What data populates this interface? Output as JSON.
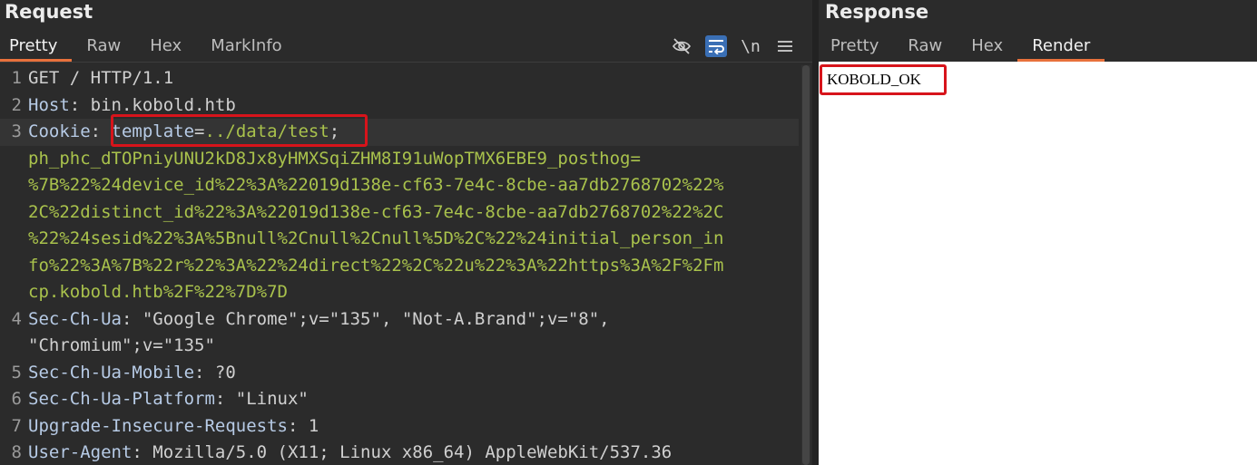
{
  "request": {
    "title": "Request",
    "tabs": [
      "Pretty",
      "Raw",
      "Hex",
      "MarkInfo"
    ],
    "active_tab": "Pretty",
    "tools": [
      {
        "name": "hide-eye-icon",
        "glyph": "",
        "active": false
      },
      {
        "name": "wrap-lines-icon",
        "glyph": "",
        "active": true
      },
      {
        "name": "newline-toggle",
        "glyph": "\\n",
        "active": false
      },
      {
        "name": "menu-icon",
        "glyph": "≡",
        "active": false
      }
    ],
    "lines": {
      "l1": {
        "num": "1",
        "text": "GET / HTTP/1.1"
      },
      "l2": {
        "num": "2",
        "key": "Host",
        "sep": ": ",
        "value": "bin.kobold.htb"
      },
      "l3": {
        "num": "3",
        "key": "Cookie",
        "sep": ": ",
        "cookie_name": "template",
        "cookie_eq": "=",
        "cookie_value": "../data/test",
        "cookie_semi": ";",
        "wrap1": "ph_phc_dTOPniyUNU2kD8Jx8yHMXSqiZHM8I91uWopTMX6EBE9_posthog=",
        "wrap2": "%7B%22%24device_id%22%3A%22019d138e-cf63-7e4c-8cbe-aa7db2768702%22%",
        "wrap3": "2C%22distinct_id%22%3A%22019d138e-cf63-7e4c-8cbe-aa7db2768702%22%2C",
        "wrap4": "%22%24sesid%22%3A%5Bnull%2Cnull%2Cnull%5D%2C%22%24initial_person_in",
        "wrap5": "fo%22%3A%7B%22r%22%3A%22%24direct%22%2C%22u%22%3A%22https%3A%2F%2Fm",
        "wrap6": "cp.kobold.htb%2F%22%7D%7D"
      },
      "l4": {
        "num": "4",
        "key": "Sec-Ch-Ua",
        "sep": ": ",
        "value": "\"Google Chrome\";v=\"135\", \"Not-A.Brand\";v=\"8\",",
        "wrap1": "\"Chromium\";v=\"135\""
      },
      "l5": {
        "num": "5",
        "key": "Sec-Ch-Ua-Mobile",
        "sep": ": ",
        "value": "?0"
      },
      "l6": {
        "num": "6",
        "key": "Sec-Ch-Ua-Platform",
        "sep": ": ",
        "value": "\"Linux\""
      },
      "l7": {
        "num": "7",
        "key": "Upgrade-Insecure-Requests",
        "sep": ": ",
        "value": "1"
      },
      "l8": {
        "num": "8",
        "key": "User-Agent",
        "sep": ": ",
        "value": "Mozilla/5.0 (X11; Linux x86_64) AppleWebKit/537.36"
      }
    }
  },
  "response": {
    "title": "Response",
    "tabs": [
      "Pretty",
      "Raw",
      "Hex",
      "Render"
    ],
    "active_tab": "Render",
    "body_text": "KOBOLD_OK"
  },
  "colors": {
    "accent_tab": "#e8713c",
    "highlight_box": "#d7141b",
    "cookie_value": "#a9c24c",
    "header_key": "#b7cbe6",
    "background": "#2b2b2b"
  }
}
